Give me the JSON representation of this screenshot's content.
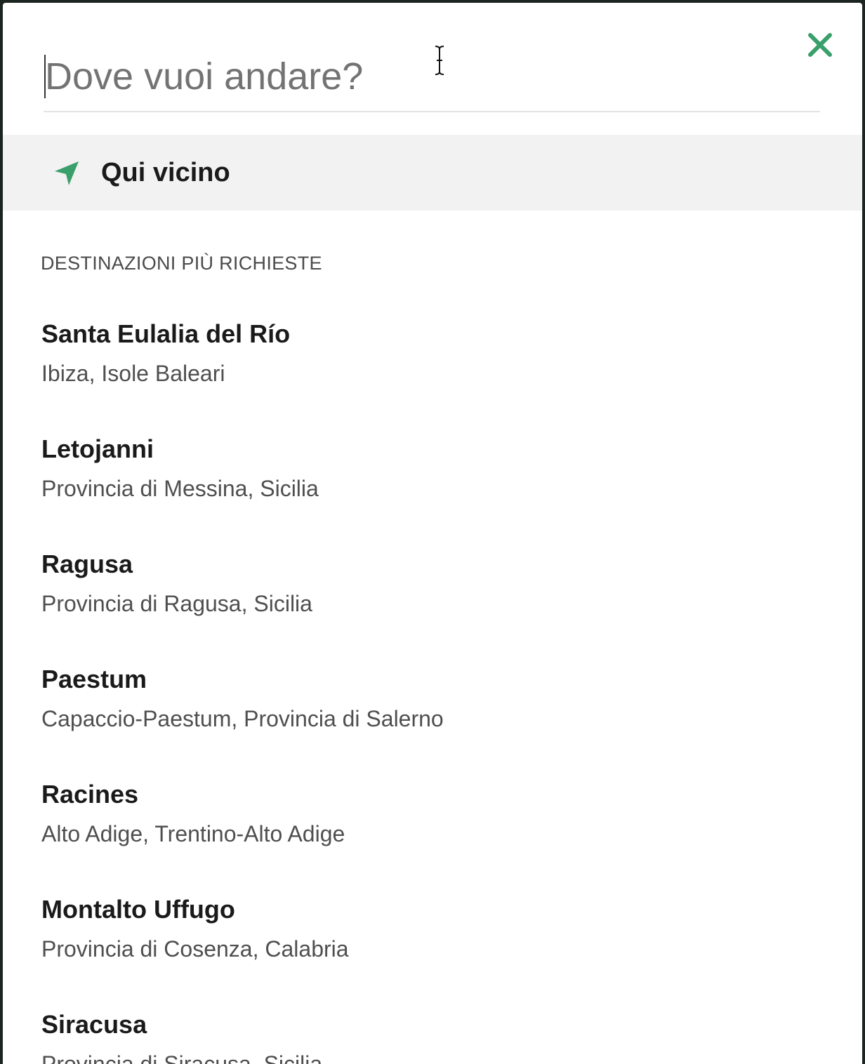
{
  "search": {
    "placeholder": "Dove vuoi andare?",
    "value": ""
  },
  "close": {
    "icon": "close-icon",
    "color": "#3aa06b"
  },
  "nearby": {
    "icon": "location-arrow-icon",
    "label": "Qui vicino",
    "color": "#3aa06b"
  },
  "popular": {
    "title": "DESTINAZIONI PIÙ RICHIESTE",
    "items": [
      {
        "name": "Santa Eulalia del Río",
        "region": "Ibiza, Isole Baleari"
      },
      {
        "name": "Letojanni",
        "region": "Provincia di Messina, Sicilia"
      },
      {
        "name": "Ragusa",
        "region": "Provincia di Ragusa, Sicilia"
      },
      {
        "name": "Paestum",
        "region": "Capaccio-Paestum, Provincia di Salerno"
      },
      {
        "name": "Racines",
        "region": "Alto Adige, Trentino-Alto Adige"
      },
      {
        "name": "Montalto Uffugo",
        "region": "Provincia di Cosenza, Calabria"
      },
      {
        "name": "Siracusa",
        "region": "Provincia di Siracusa, Sicilia"
      }
    ]
  }
}
